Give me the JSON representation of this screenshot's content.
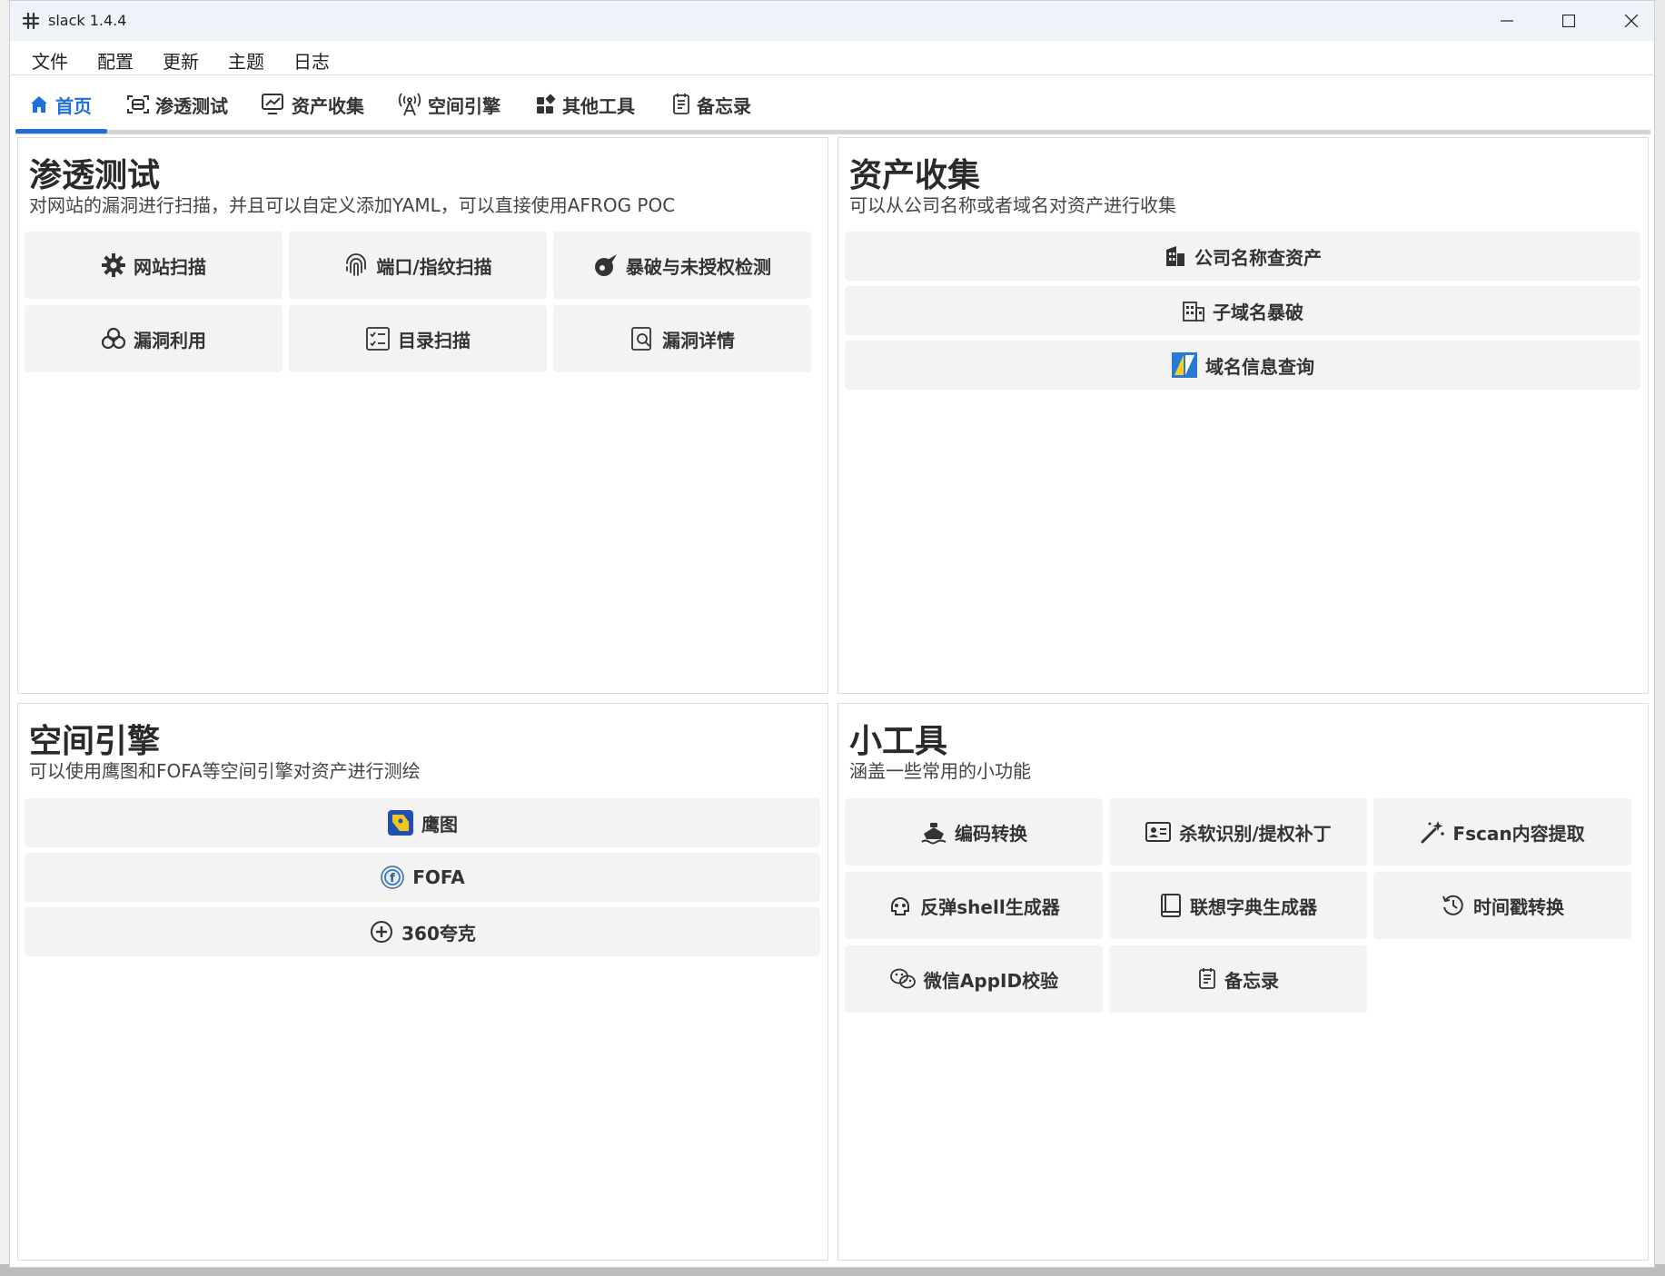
{
  "window": {
    "title": "slack 1.4.4"
  },
  "menu": [
    "文件",
    "配置",
    "更新",
    "主题",
    "日志"
  ],
  "tabs": [
    "首页",
    "渗透测试",
    "资产收集",
    "空间引擎",
    "其他工具",
    "备忘录"
  ],
  "panels": {
    "pentest": {
      "title": "渗透测试",
      "desc": "对网站的漏洞进行扫描，并且可以自定义添加YAML，可以直接使用AFROG POC",
      "buttons": [
        "网站扫描",
        "端口/指纹扫描",
        "暴破与未授权检测",
        "漏洞利用",
        "目录扫描",
        "漏洞详情"
      ]
    },
    "assets": {
      "title": "资产收集",
      "desc": "可以从公司名称或者域名对资产进行收集",
      "buttons": [
        "公司名称查资产",
        "子域名暴破",
        "域名信息查询"
      ]
    },
    "space": {
      "title": "空间引擎",
      "desc": "可以使用鹰图和FOFA等空间引擎对资产进行测绘",
      "buttons": [
        "鹰图",
        "FOFA",
        "360夸克"
      ]
    },
    "tools": {
      "title": "小工具",
      "desc": "涵盖一些常用的小功能",
      "buttons": [
        "编码转换",
        "杀软识别/提权补丁",
        "Fscan内容提取",
        "反弹shell生成器",
        "联想字典生成器",
        "时间戳转换",
        "微信AppID校验",
        "备忘录"
      ]
    }
  },
  "colors": {
    "accent": "#1e6fd9",
    "button_bg": "#f3f3f3",
    "titlebar_bg": "#eef3fa"
  }
}
